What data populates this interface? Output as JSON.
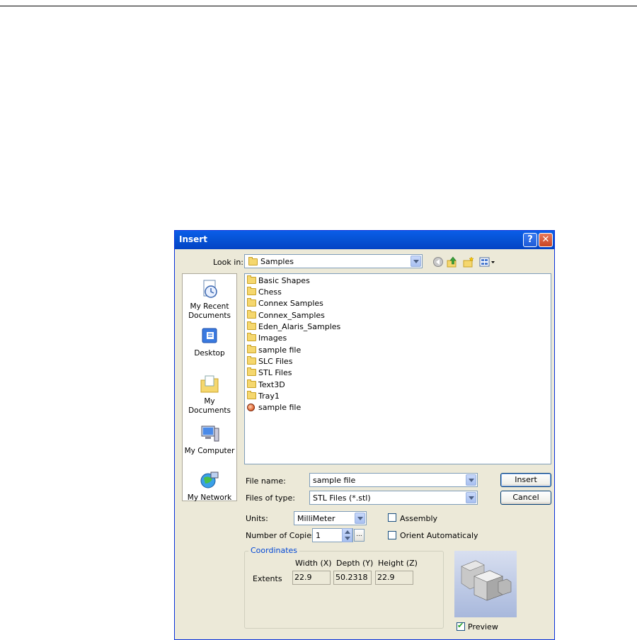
{
  "dialog": {
    "title": "Insert",
    "help_glyph": "?",
    "close_glyph": "✕"
  },
  "look_in": {
    "label": "Look in:",
    "value": "Samples"
  },
  "toolbar_icons": [
    "back-icon",
    "up-folder-icon",
    "new-folder-icon",
    "views-menu-icon"
  ],
  "places": [
    {
      "label": "My Recent Documents",
      "icon": "recent-documents-icon"
    },
    {
      "label": "Desktop",
      "icon": "desktop-icon"
    },
    {
      "label": "My Documents",
      "icon": "my-documents-icon"
    },
    {
      "label": "My Computer",
      "icon": "my-computer-icon"
    },
    {
      "label": "My Network",
      "icon": "my-network-icon"
    }
  ],
  "files": [
    {
      "name": "Basic Shapes",
      "type": "folder"
    },
    {
      "name": "Chess",
      "type": "folder"
    },
    {
      "name": "Connex Samples",
      "type": "folder"
    },
    {
      "name": "Connex_Samples",
      "type": "folder"
    },
    {
      "name": "Eden_Alaris_Samples",
      "type": "folder"
    },
    {
      "name": "Images",
      "type": "folder"
    },
    {
      "name": "sample file",
      "type": "folder"
    },
    {
      "name": "SLC Files",
      "type": "folder"
    },
    {
      "name": "STL Files",
      "type": "folder"
    },
    {
      "name": "Text3D",
      "type": "folder"
    },
    {
      "name": "Tray1",
      "type": "folder"
    },
    {
      "name": "sample file",
      "type": "stl"
    }
  ],
  "file_name": {
    "label": "File name:",
    "value": "sample file"
  },
  "files_of_type": {
    "label": "Files of type:",
    "value": "STL Files (*.stl)"
  },
  "buttons": {
    "insert": "Insert",
    "cancel": "Cancel"
  },
  "units": {
    "label": "Units:",
    "value": "MilliMeter"
  },
  "copies": {
    "label": "Number of Copies :",
    "value": "1",
    "ellipsis": "..."
  },
  "assembly": {
    "label": "Assembly",
    "checked": false
  },
  "orient": {
    "label": "Orient Automaticaly",
    "checked": false
  },
  "coordinates": {
    "title": "Coordinates",
    "headers": [
      "Width (X)",
      "Depth (Y)",
      "Height (Z)"
    ],
    "row_label": "Extents",
    "values": [
      "22.9",
      "50.2318",
      "22.9"
    ]
  },
  "preview": {
    "label": "Preview",
    "checked": true
  },
  "colors": {
    "titlebar": "#0653d6",
    "dialog_bg": "#ece9d8",
    "group_title": "#0046d5"
  }
}
